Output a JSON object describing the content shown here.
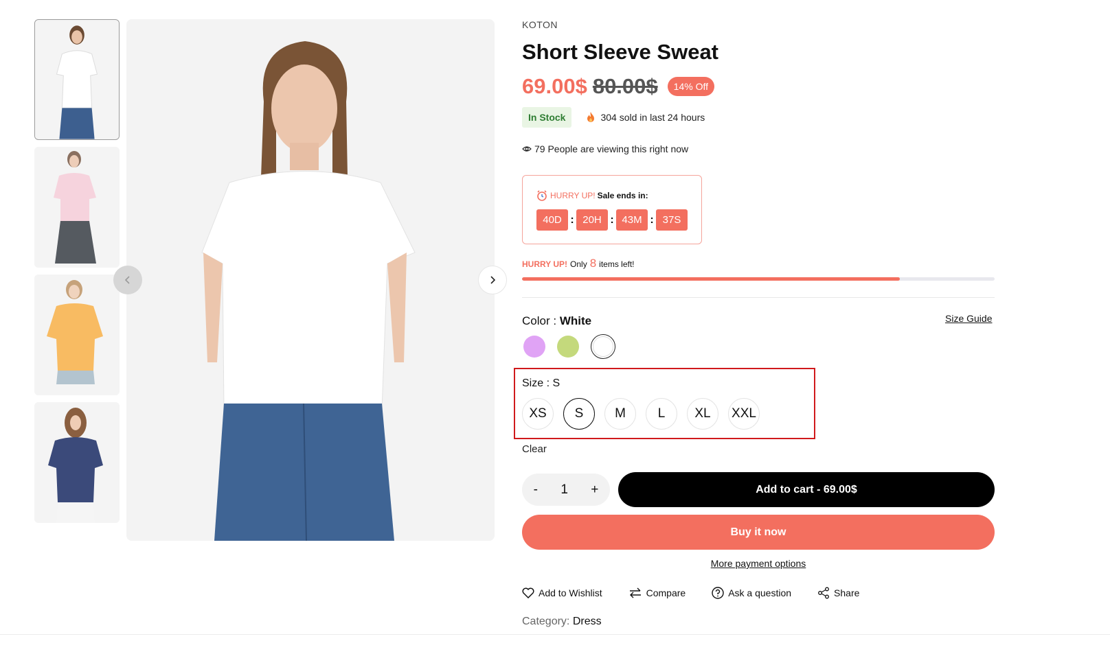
{
  "gallery": {
    "thumbnails": [
      {
        "alt": "white-tshirt-thumb"
      },
      {
        "alt": "pink-tshirt-thumb"
      },
      {
        "alt": "orange-tshirt-thumb"
      },
      {
        "alt": "navy-tshirt-thumb"
      }
    ],
    "prev_icon": "chevron-left-icon",
    "next_icon": "chevron-right-icon"
  },
  "product": {
    "brand": "KOTON",
    "title": "Short Sleeve Sweat",
    "price_now": "69.00$",
    "price_old": "80.00$",
    "discount": "14% Off",
    "stock_status": "In Stock",
    "sold_text": "304 sold in last 24 hours",
    "viewing_text": "79 People are viewing this right now"
  },
  "countdown": {
    "hurry": "HURRY UP!",
    "label": "Sale ends in:",
    "days": "40D",
    "hours": "20H",
    "minutes": "43M",
    "seconds": "37S"
  },
  "stock_alert": {
    "hurry": "HURRY UP!",
    "only": "Only",
    "count": "8",
    "suffix": "items left!",
    "progress_fraction": 0.8
  },
  "color": {
    "label": "Color :",
    "value": "White",
    "size_guide": "Size Guide",
    "swatches": [
      "#e0a3f5",
      "#c4d97c",
      "#ffffff"
    ]
  },
  "size": {
    "label": "Size :",
    "value": "S",
    "options": [
      "XS",
      "S",
      "M",
      "L",
      "XL",
      "XXL"
    ],
    "clear": "Clear"
  },
  "cart": {
    "minus": "-",
    "quantity": "1",
    "plus": "+",
    "add_to_cart": "Add to cart - 69.00$",
    "buy_now": "Buy it now",
    "more_payment": "More payment options"
  },
  "actions": {
    "wishlist": "Add to Wishlist",
    "compare": "Compare",
    "ask": "Ask a question",
    "share": "Share"
  },
  "meta": {
    "category_label": "Category:",
    "category_value": "Dress"
  },
  "colors": {
    "accent": "#f36f5f",
    "in_stock_bg": "#e9f5e4",
    "in_stock_text": "#2e7d32",
    "highlight_border": "#d0191b"
  }
}
